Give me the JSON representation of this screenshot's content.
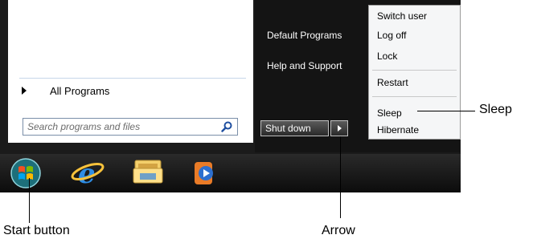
{
  "left_pane": {
    "all_programs": "All Programs",
    "search_placeholder": "Search programs and files"
  },
  "right_pane": {
    "items": [
      "Default Programs",
      "Help and Support"
    ]
  },
  "power": {
    "shutdown_label": "Shut down"
  },
  "submenu": {
    "switch_user": "Switch user",
    "log_off": "Log off",
    "lock": "Lock",
    "restart": "Restart",
    "sleep": "Sleep",
    "hibernate": "Hibernate"
  },
  "taskbar": {
    "icons": [
      "windows-orb-icon",
      "internet-explorer-icon",
      "windows-explorer-icon",
      "media-player-icon"
    ]
  },
  "annotations": {
    "sleep": "Sleep",
    "start_button": "Start button",
    "arrow": "Arrow"
  },
  "colors": {
    "menu_frame": "#1b1b1b",
    "taskbar": "#0c0c0c",
    "submenu_bg": "#f5f6f7"
  }
}
